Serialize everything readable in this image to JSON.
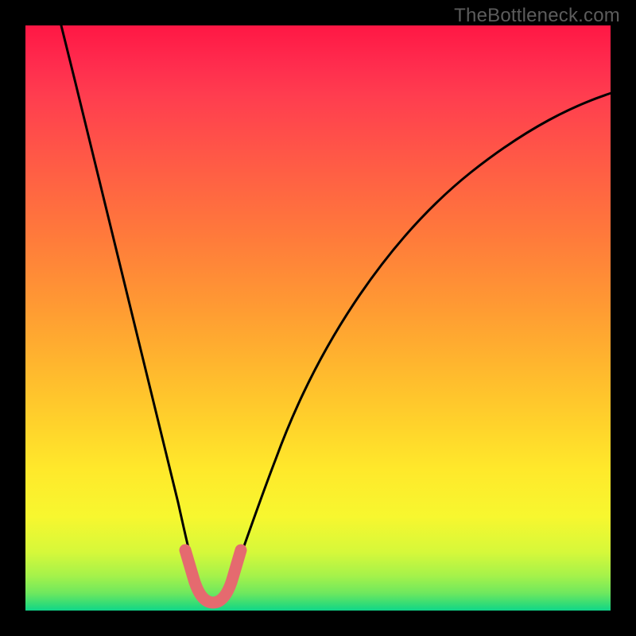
{
  "watermark": "TheBottleneck.com",
  "colors": {
    "background": "#000000",
    "gradient_top": "#ff1744",
    "gradient_mid_orange": "#ff7a3b",
    "gradient_mid_yellow": "#ffe92b",
    "gradient_bottom": "#10d68a",
    "curve_stroke": "#000000",
    "trough_stroke": "#e56a6f"
  },
  "chart_data": {
    "type": "line",
    "title": "",
    "xlabel": "",
    "ylabel": "",
    "x": [
      0.0,
      0.02,
      0.04,
      0.06,
      0.08,
      0.1,
      0.12,
      0.14,
      0.16,
      0.18,
      0.2,
      0.22,
      0.24,
      0.26,
      0.28,
      0.3,
      0.32,
      0.34,
      0.36,
      0.38,
      0.4,
      0.45,
      0.5,
      0.55,
      0.6,
      0.65,
      0.7,
      0.75,
      0.8,
      0.85,
      0.9,
      0.95,
      1.0
    ],
    "series": [
      {
        "name": "bottleneck_curve",
        "values": [
          1.0,
          0.93,
          0.86,
          0.79,
          0.72,
          0.65,
          0.58,
          0.5,
          0.43,
          0.35,
          0.27,
          0.19,
          0.11,
          0.05,
          0.02,
          0.0,
          0.0,
          0.02,
          0.06,
          0.12,
          0.18,
          0.3,
          0.41,
          0.5,
          0.57,
          0.63,
          0.68,
          0.72,
          0.76,
          0.79,
          0.82,
          0.84,
          0.86
        ]
      }
    ],
    "xlim": [
      0,
      1
    ],
    "ylim": [
      0,
      1
    ],
    "trough": {
      "x_start": 0.27,
      "x_end": 0.35,
      "y": 0.0,
      "y_max_at_ends": 0.1
    },
    "annotations": []
  }
}
